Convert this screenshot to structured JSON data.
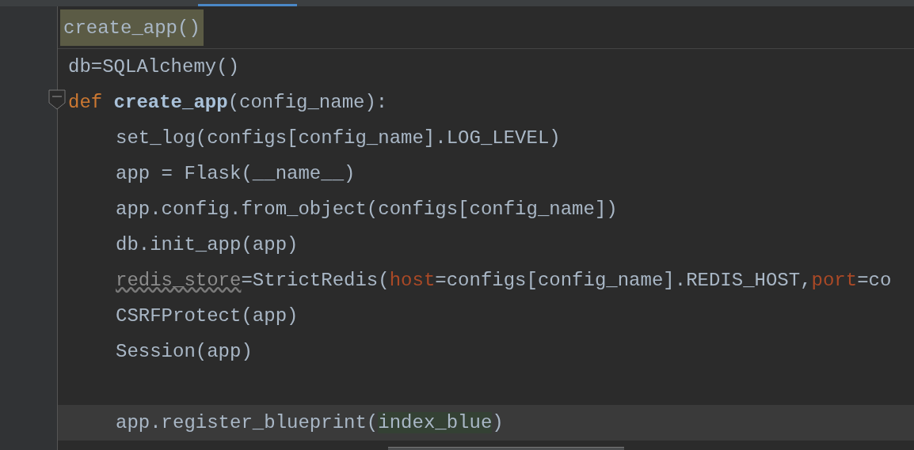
{
  "hint": {
    "text": "create_app()"
  },
  "lines": [
    {
      "kind": "code",
      "tokens": [
        {
          "text": "db=SQLAlchemy()",
          "kind": "plain"
        }
      ]
    },
    {
      "kind": "code",
      "fold": true,
      "tokens": [
        {
          "text": "def ",
          "kind": "keyword"
        },
        {
          "text": "create_app",
          "kind": "function"
        },
        {
          "text": "(config_name):",
          "kind": "plain"
        }
      ],
      "children": [
        {
          "kind": "code",
          "tokens": [
            {
              "text": "set_log(configs[config_name].LOG_LEVEL)",
              "kind": "plain"
            }
          ]
        },
        {
          "kind": "code",
          "tokens": [
            {
              "text": "app = Flask(__name__)",
              "kind": "plain"
            }
          ]
        },
        {
          "kind": "code",
          "tokens": [
            {
              "text": "app.config.from_object(configs[config_name])",
              "kind": "plain"
            }
          ]
        },
        {
          "kind": "code",
          "tokens": [
            {
              "text": "db.init_app(app)",
              "kind": "plain"
            }
          ]
        },
        {
          "kind": "code",
          "tokens": [
            {
              "text": "redis_store",
              "kind": "unused"
            },
            {
              "text": "=StrictRedis(",
              "kind": "plain"
            },
            {
              "text": "host",
              "kind": "param"
            },
            {
              "text": "=configs[config_name].REDIS_HOST,",
              "kind": "plain"
            },
            {
              "text": "port",
              "kind": "param"
            },
            {
              "text": "=co",
              "kind": "plain"
            }
          ]
        },
        {
          "kind": "code",
          "tokens": [
            {
              "text": "CSRFProtect(app)",
              "kind": "plain"
            }
          ]
        },
        {
          "kind": "code",
          "tokens": [
            {
              "text": "Session(app)",
              "kind": "plain"
            }
          ]
        },
        {
          "kind": "blank"
        },
        {
          "kind": "code",
          "current": true,
          "tokens": [
            {
              "text": "app.register_blueprint(",
              "kind": "plain"
            },
            {
              "text": "index_blue",
              "kind": "match"
            },
            {
              "text": ")",
              "kind": "plain"
            }
          ]
        }
      ]
    }
  ]
}
